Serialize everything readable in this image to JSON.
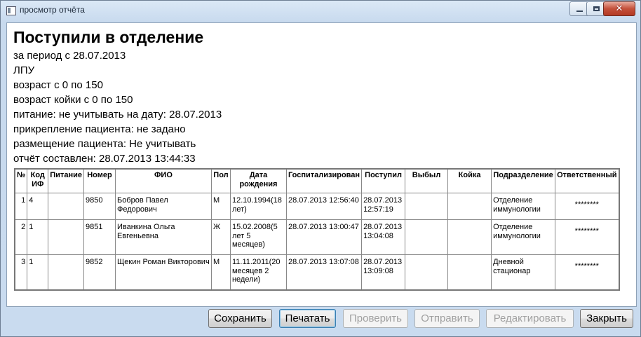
{
  "window": {
    "title": "просмотр отчёта"
  },
  "report": {
    "title": "Поступили в отделение",
    "lines": [
      "за период с 28.07.2013",
      "ЛПУ",
      "возраст с 0 по 150",
      "возраст койки с 0 по 150",
      "питание: не учитывать на дату: 28.07.2013",
      "прикрепление пациента: не задано",
      "размещение пациента: Не учитывать",
      "отчёт составлен: 28.07.2013 13:44:33"
    ]
  },
  "table": {
    "headers": [
      "№",
      "Код ИФ",
      "Питание",
      "Номер",
      "ФИО",
      "Пол",
      "Дата рождения",
      "Госпитализирован",
      "Поступил",
      "Выбыл",
      "Койка",
      "Подразделение",
      "Ответственный"
    ],
    "rows": [
      {
        "no": "1",
        "code": "4",
        "food": "",
        "number": "9850",
        "fio": "Бобров Павел Федорович",
        "sex": "М",
        "birth": "12.10.1994(18 лет)",
        "hosp": "28.07.2013 12:56:40",
        "arrived": "28.07.2013 12:57:19",
        "left": "",
        "bed": "",
        "dept": "Отделение иммунологии",
        "resp": "********"
      },
      {
        "no": "2",
        "code": "1",
        "food": "",
        "number": "9851",
        "fio": "Иванкина Ольга Евгеньевна",
        "sex": "Ж",
        "birth": "15.02.2008(5 лет 5 месяцев)",
        "hosp": "28.07.2013 13:00:47",
        "arrived": "28.07.2013 13:04:08",
        "left": "",
        "bed": "",
        "dept": "Отделение иммунологии",
        "resp": "********"
      },
      {
        "no": "3",
        "code": "1",
        "food": "",
        "number": "9852",
        "fio": "Щекин Роман Викторович",
        "sex": "М",
        "birth": "11.11.2011(20 месяцев 2 недели)",
        "hosp": "28.07.2013 13:07:08",
        "arrived": "28.07.2013 13:09:08",
        "left": "",
        "bed": "",
        "dept": "Дневной стационар",
        "resp": "********"
      }
    ]
  },
  "buttons": {
    "save": "Сохранить",
    "print": "Печатать",
    "check": "Проверить",
    "send": "Отправить",
    "edit": "Редактировать",
    "close": "Закрыть"
  }
}
